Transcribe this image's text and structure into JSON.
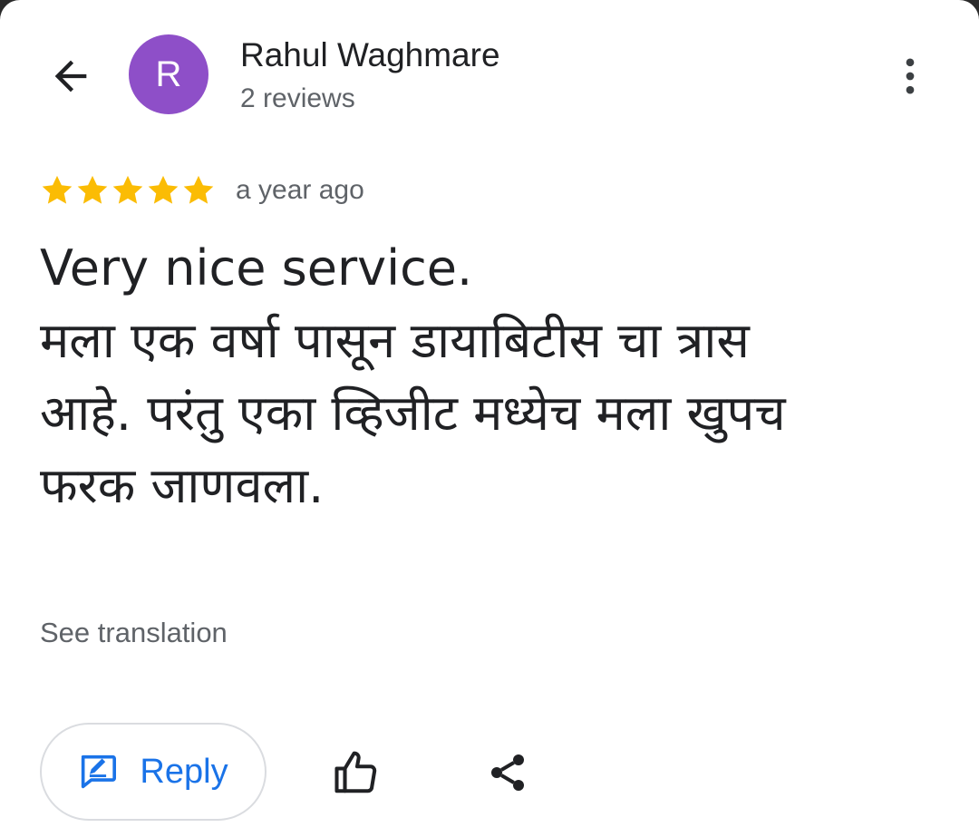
{
  "header": {
    "back_icon": "arrow-back-icon",
    "avatar_initial": "R",
    "avatar_color": "#8e4fc8",
    "author_name": "Rahul Waghmare",
    "author_reviews": "2 reviews",
    "more_icon": "more-vert-icon"
  },
  "review": {
    "rating": 5,
    "max_rating": 5,
    "star_color": "#fbbc04",
    "time": "a year ago",
    "text_lines": [
      "Very nice service.",
      "मला एक वर्षा पासून डायाबिटीस चा त्रास",
      "आहे. परंतु एका व्हिजीट मध्येच मला खुपच",
      "फरक जाणवला."
    ],
    "see_translation": "See translation"
  },
  "actions": {
    "reply_icon": "reply-edit-icon",
    "reply_label": "Reply",
    "reply_color": "#1a73e8",
    "like_icon": "thumb-up-icon",
    "share_icon": "share-icon"
  }
}
